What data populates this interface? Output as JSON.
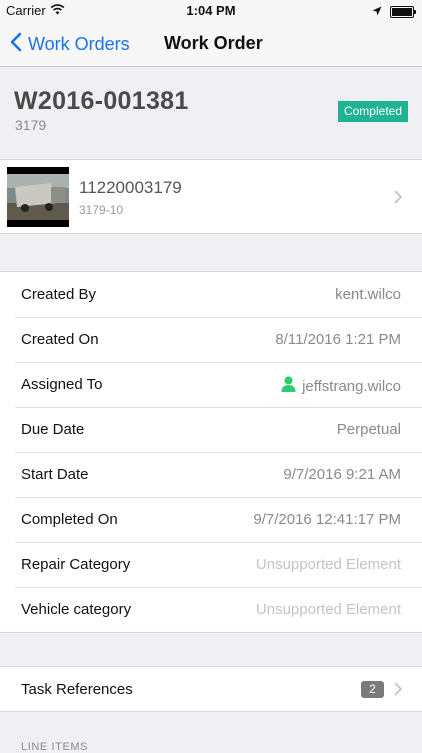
{
  "status_bar": {
    "carrier": "Carrier",
    "time": "1:04 PM",
    "battery_level": 1.0
  },
  "nav": {
    "back_label": "Work Orders",
    "title": "Work Order",
    "accent_color": "#1a73e8"
  },
  "work_order": {
    "number": "W2016-001381",
    "subtitle": "3179",
    "status": "Completed",
    "status_color": "#1fb392"
  },
  "vehicle": {
    "id": "11220003179",
    "subtitle": "3179-10",
    "thumbnail_icon": "vehicle-photo"
  },
  "details": [
    {
      "label": "Created By",
      "value": "kent.wilco"
    },
    {
      "label": "Created On",
      "value": "8/11/2016 1:21 PM"
    },
    {
      "label": "Assigned To",
      "value": "jeffstrang.wilco",
      "icon": "user-icon"
    },
    {
      "label": "Due Date",
      "value": "Perpetual"
    },
    {
      "label": "Start Date",
      "value": "9/7/2016 9:21 AM"
    },
    {
      "label": "Completed On",
      "value": "9/7/2016 12:41:17 PM"
    },
    {
      "label": "Repair Category",
      "value": "Unsupported Element"
    },
    {
      "label": "Vehicle category",
      "value": "Unsupported Element"
    }
  ],
  "task_references": {
    "label": "Task References",
    "count": "2"
  },
  "line_items_header": "LINE ITEMS"
}
